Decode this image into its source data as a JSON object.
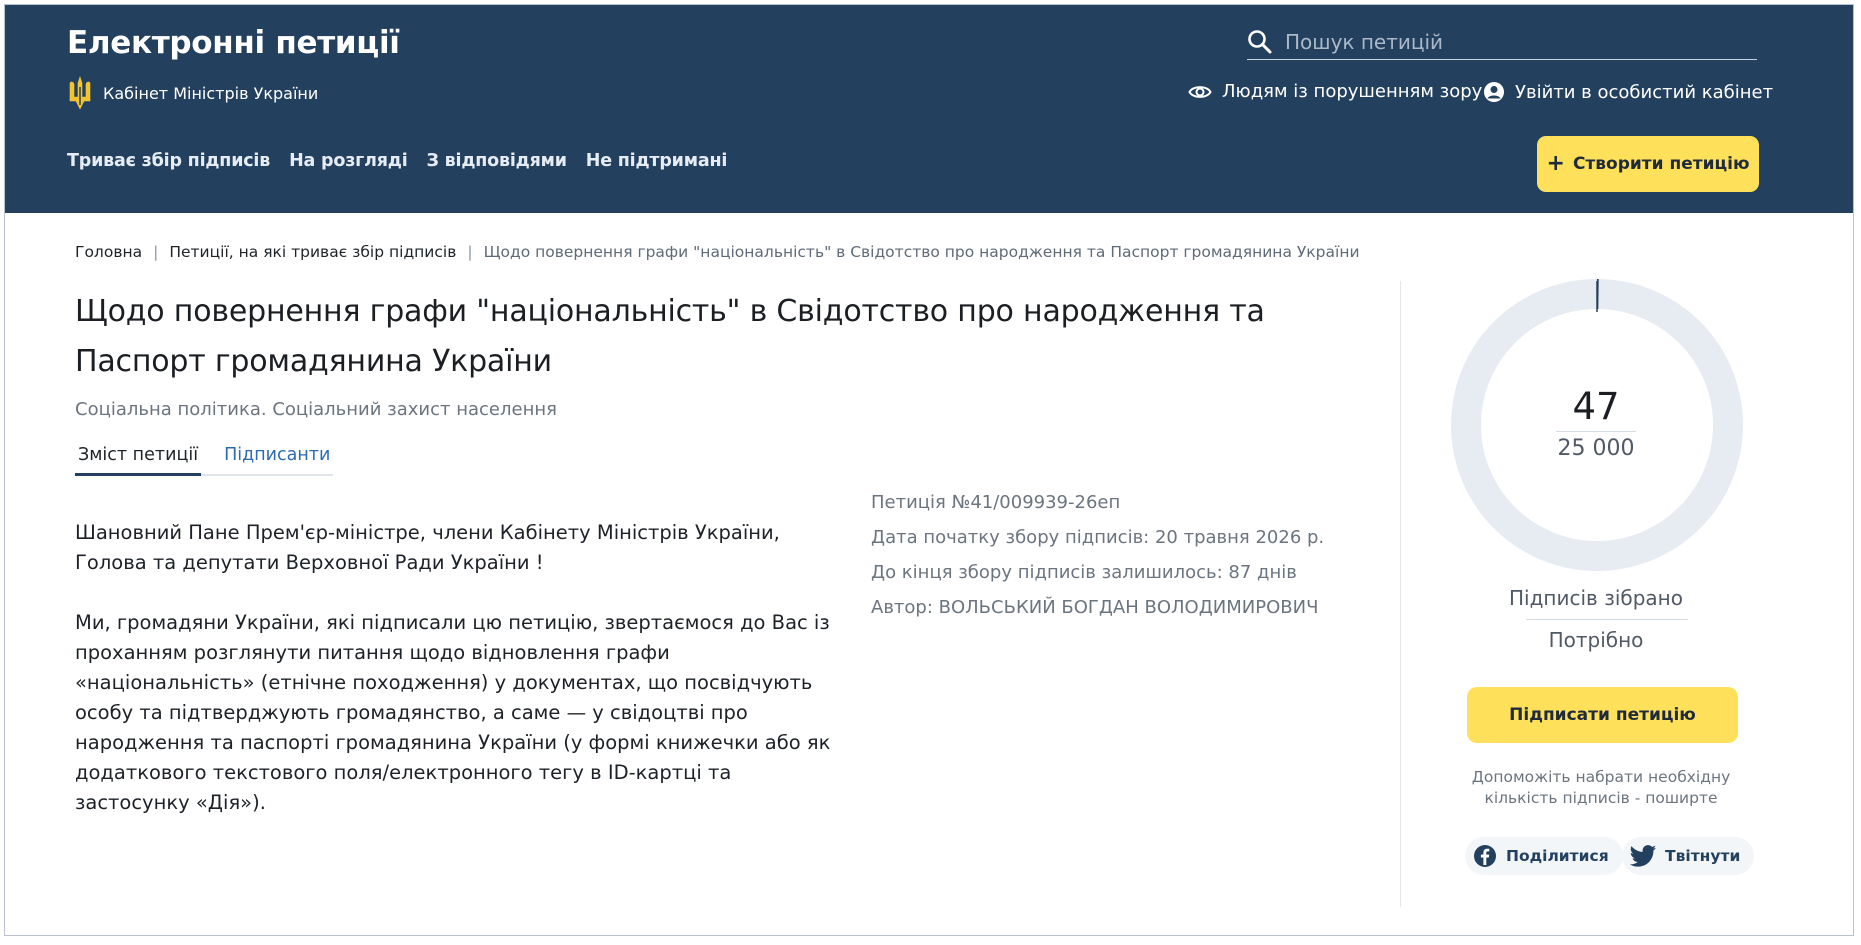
{
  "header": {
    "site_title": "Електронні петиції",
    "cabinet_label": "Кабінет Міністрів України",
    "search_placeholder": "Пошук петицій",
    "accessibility_label": "Людям із порушенням зору",
    "login_label": "Увійти в особистий кабінет",
    "nav": [
      "Триває збір підписів",
      "На розгляді",
      "З відповідями",
      "Не підтримані"
    ],
    "create_label": "Створити петицію"
  },
  "breadcrumb": {
    "home": "Головна",
    "section": "Петиції, на які триває збір підписів",
    "current": "Щодо повернення графи \"національність\" в Свідотство про народження та Паспорт громадянина України"
  },
  "petition": {
    "title": "Щодо повернення графи \"національність\" в Свідотство про народження та Паспорт громадянина України",
    "category": "Соціальна політика. Соціальний захист населення",
    "tabs": {
      "content": "Зміст петиції",
      "signers": "Підписанти"
    },
    "paragraphs": [
      "Шановний Пане Прем'єр-міністре, члени Кабінету Міністрів України, Голова та депутати Верховної Ради України !",
      "Ми, громадяни України, які підписали цю петицію, звертаємося до Вас із проханням розглянути питання щодо відновлення графи «національність» (етнічне походження) у документах, що посвідчують особу та підтверджують громадянство, а саме — у свідоцтві про народження та паспорті громадянина України (у формі книжечки або як додаткового текстового поля/електронного тегу в ID-картці та застосунку «Дія»)."
    ],
    "meta": {
      "number": "Петиція №41/009939-26еп",
      "start_date": "Дата початку збору підписів: 20 травня 2026 р.",
      "remaining": "До кінця збору підписів залишилось: 87 днів",
      "author": "Автор: ВОЛЬСЬКИЙ БОГДАН ВОЛОДИМИРОВИЧ"
    }
  },
  "sidebar": {
    "collected": "47",
    "required": "25 000",
    "progress_fraction": 0.00188,
    "collected_label": "Підписів зібрано",
    "required_label": "Потрібно",
    "sign_label": "Підписати петицію",
    "help_text": "Допоможіть набрати необхідну кількість підписів - поширте",
    "share_fb": "Поділитися",
    "share_tw": "Твітнути"
  },
  "colors": {
    "header_bg": "#24405f",
    "accent_yellow": "#ffe05a",
    "donut_track": "#e6ecf2",
    "donut_progress": "#24405f"
  }
}
